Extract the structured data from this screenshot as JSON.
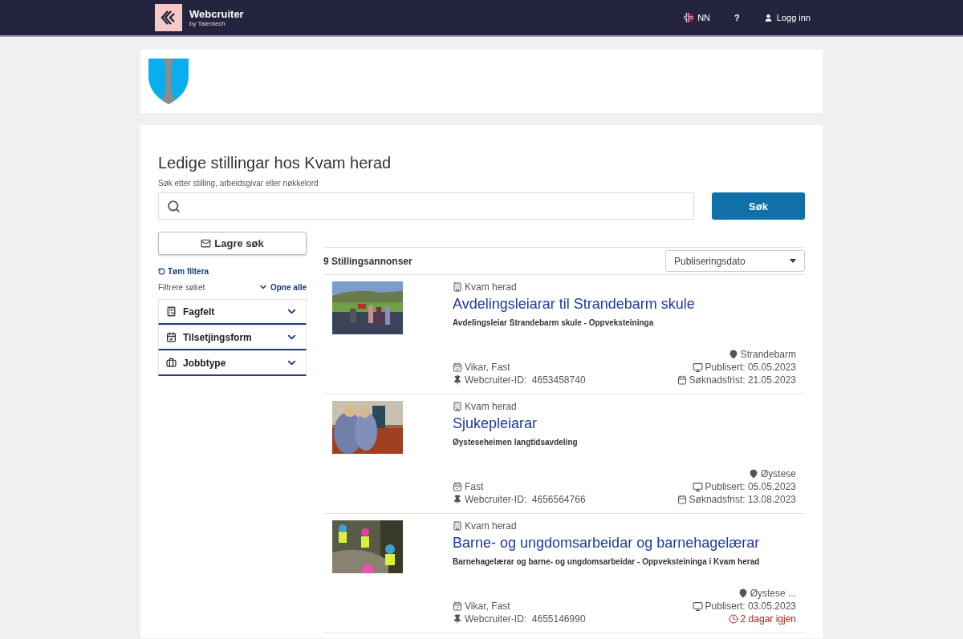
{
  "header": {
    "brand": "Webcruiter",
    "brand_sub": "by Talentech",
    "language": "NN",
    "help": "?",
    "login": "Logg inn"
  },
  "page": {
    "title": "Ledige stillingar hos Kvam herad",
    "search_label": "Søk etter stilling, arbeidsgivar eller nøkkelord",
    "search_button": "Søk"
  },
  "sidebar": {
    "save_search": "Lagre søk",
    "clear_filters": "Tøm filtera",
    "filter_label": "Filtrere søket",
    "open_all": "Opne alle",
    "filters": [
      {
        "label": "Fagfelt",
        "expanded": false
      },
      {
        "label": "Tilsetjingsform",
        "expanded": false
      },
      {
        "label": "Jobbtype",
        "expanded": false
      }
    ]
  },
  "results": {
    "count": "9 Stillingsannonser",
    "sort": "Publiseringsdato",
    "jobs": [
      {
        "employer": "Kvam herad",
        "title": "Avdelingsleiarar til Strandebarm skule",
        "subtitle": "Avdelingsleiar Strandebarm skule - Oppveksteininga",
        "location": "Strandebarm",
        "employment": "Vikar, Fast",
        "id_label": "Webcruiter-ID:",
        "id": "4653458740",
        "published": "Publisert: 05.05.2023",
        "deadline": {
          "kind": "date",
          "text": "Søknadsfrist: 21.05.2023"
        }
      },
      {
        "employer": "Kvam herad",
        "title": "Sjukepleiarar",
        "subtitle": "Øysteseheimen langtidsavdeling",
        "location": "Øystese",
        "employment": "Fast",
        "id_label": "Webcruiter-ID:",
        "id": "4656564766",
        "published": "Publisert: 05.05.2023",
        "deadline": {
          "kind": "date",
          "text": "Søknadsfrist: 13.08.2023"
        }
      },
      {
        "employer": "Kvam herad",
        "title": "Barne- og ungdomsarbeidar og barnehagelærar",
        "subtitle": "Barnehagelærar og barne- og ungdomsarbeidar - Oppveksteininga i Kvam herad",
        "location": "Øystese ...",
        "employment": "Vikar, Fast",
        "id_label": "Webcruiter-ID:",
        "id": "4655146990",
        "published": "Publisert: 03.05.2023",
        "deadline": {
          "kind": "urgent",
          "text": "2 dagar igjen"
        }
      }
    ]
  }
}
